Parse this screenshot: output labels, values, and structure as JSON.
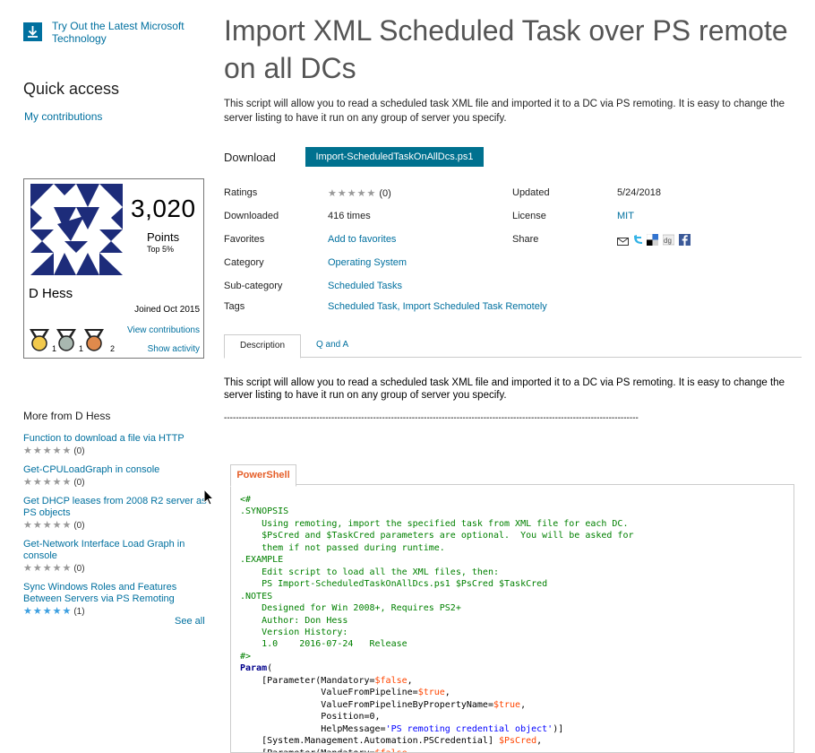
{
  "promo": {
    "text": "Try Out the Latest Microsoft Technology",
    "icon": "download-icon"
  },
  "quick_access": {
    "title": "Quick access",
    "my_contributions": "My contributions"
  },
  "profile": {
    "points": "3,020",
    "points_label": "Points",
    "top_rank": "Top 5%",
    "name": "D Hess",
    "joined": "Joined Oct 2015",
    "medals": [
      {
        "icon": "gold-medal-icon",
        "count": "1",
        "color": "#f2c94c"
      },
      {
        "icon": "silver-medal-icon",
        "count": "1",
        "color": "#a9b8b0"
      },
      {
        "icon": "bronze-medal-icon",
        "count": "2",
        "color": "#e08a4c"
      }
    ],
    "view_contributions": "View contributions",
    "show_activity": "Show activity"
  },
  "more_from": {
    "title": "More from D Hess",
    "items": [
      {
        "title": "Function to download a file via HTTP",
        "stars": "★★★★★",
        "count": "(0)",
        "rated": false
      },
      {
        "title": "Get-CPULoadGraph in console",
        "stars": "★★★★★",
        "count": "(0)",
        "rated": false
      },
      {
        "title": "Get DHCP leases from 2008 R2 server as PS objects",
        "stars": "★★★★★",
        "count": "(0)",
        "rated": false
      },
      {
        "title": "Get-Network Interface Load Graph in console",
        "stars": "★★★★★",
        "count": "(0)",
        "rated": false
      },
      {
        "title": "Sync Windows Roles and Features Between Servers via PS Remoting",
        "stars": "★★★★★",
        "count": "(1)",
        "rated": true
      }
    ],
    "see_all": "See all"
  },
  "page": {
    "title": "Import XML Scheduled Task over PS remote on all DCs",
    "summary": "This script will allow you to read a scheduled task XML file and imported it to a DC via PS remoting.  It is easy to change the server listing to have it run on any group of server you specify.",
    "download_label": "Download",
    "download_file": "Import-ScheduledTaskOnAllDcs.ps1"
  },
  "meta": {
    "ratings_label": "Ratings",
    "ratings_stars": "★★★★★",
    "ratings_count": "(0)",
    "updated_label": "Updated",
    "updated_value": "5/24/2018",
    "downloaded_label": "Downloaded",
    "downloaded_value": "416 times",
    "license_label": "License",
    "license_value": "MIT",
    "favorites_label": "Favorites",
    "favorites_value": "Add to favorites",
    "share_label": "Share",
    "category_label": "Category",
    "category_value": "Operating System",
    "subcategory_label": "Sub-category",
    "subcategory_value": "Scheduled Tasks",
    "tags_label": "Tags",
    "tags_value": "Scheduled Task, Import Scheduled Task Remotely"
  },
  "share_icons": [
    "email-icon",
    "twitter-icon",
    "delicious-icon",
    "digg-icon",
    "facebook-icon"
  ],
  "tabs": {
    "description": "Description",
    "qa": "Q and A"
  },
  "description": {
    "text": "This script will allow you to read a scheduled task XML file and imported it to a DC via PS remoting.  It is easy to change the server listing to have it run on any group of server you specify.",
    "separator": "-------------------------------------------------------------------------------------------------------------------------------------------"
  },
  "code": {
    "language": "PowerShell",
    "lines": [
      [
        [
          "cm",
          "<#"
        ]
      ],
      [
        [
          "cm",
          ".SYNOPSIS"
        ]
      ],
      [
        [
          "cm",
          "    Using remoting, import the specified task from XML file for each DC."
        ]
      ],
      [
        [
          "cm",
          "    $PsCred and $TaskCred parameters are optional.  You will be asked for"
        ]
      ],
      [
        [
          "cm",
          "    them if not passed during runtime."
        ]
      ],
      [
        [
          "cm",
          ".EXAMPLE"
        ]
      ],
      [
        [
          "cm",
          "    Edit script to load all the XML files, then:"
        ]
      ],
      [
        [
          "cm",
          "    PS Import-ScheduledTaskOnAllDcs.ps1 $PsCred $TaskCred"
        ]
      ],
      [
        [
          "cm",
          ".NOTES"
        ]
      ],
      [
        [
          "cm",
          "    Designed for Win 2008+, Requires PS2+"
        ]
      ],
      [
        [
          "cm",
          "    Author: Don Hess"
        ]
      ],
      [
        [
          "cm",
          "    Version History:"
        ]
      ],
      [
        [
          "cm",
          "    1.0    2016-07-24   Release"
        ]
      ],
      [
        [
          "cm",
          "#>"
        ]
      ],
      [
        [
          "kw",
          "Param"
        ],
        [
          "tx",
          "("
        ]
      ],
      [
        [
          "tx",
          "    [Parameter(Mandatory="
        ],
        [
          "vr",
          "$false"
        ],
        [
          "tx",
          ","
        ]
      ],
      [
        [
          "tx",
          "               ValueFromPipeline="
        ],
        [
          "vr",
          "$true"
        ],
        [
          "tx",
          ","
        ]
      ],
      [
        [
          "tx",
          "               ValueFromPipelineByPropertyName="
        ],
        [
          "vr",
          "$true"
        ],
        [
          "tx",
          ","
        ]
      ],
      [
        [
          "tx",
          "               Position=0,"
        ]
      ],
      [
        [
          "tx",
          "               HelpMessage="
        ],
        [
          "st",
          "'PS remoting credential object'"
        ],
        [
          "tx",
          ")]"
        ]
      ],
      [
        [
          "tx",
          "    [System.Management.Automation.PSCredential] "
        ],
        [
          "vr",
          "$PsCred"
        ],
        [
          "tx",
          ","
        ]
      ],
      [
        [
          "tx",
          "    [Parameter(Mandatory="
        ],
        [
          "vr",
          "$false"
        ],
        [
          "tx",
          ","
        ]
      ]
    ]
  }
}
